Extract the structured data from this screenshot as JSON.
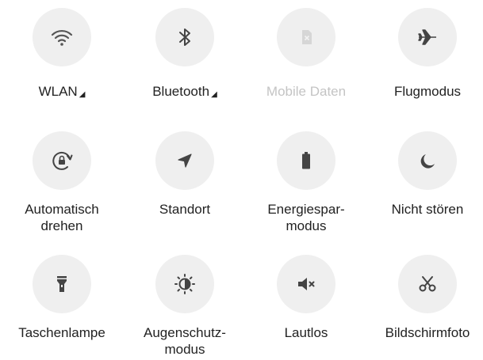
{
  "quick_settings": {
    "tiles": [
      {
        "label": "WLAN",
        "icon": "wifi-icon",
        "has_arrow": true,
        "enabled": true
      },
      {
        "label": "Bluetooth",
        "icon": "bluetooth-icon",
        "has_arrow": true,
        "enabled": true
      },
      {
        "label": "Mobile Daten",
        "icon": "sim-card-icon",
        "has_arrow": false,
        "enabled": false
      },
      {
        "label": "Flugmodus",
        "icon": "airplane-icon",
        "has_arrow": false,
        "enabled": true
      },
      {
        "label": "Automatisch\ndrehen",
        "icon": "auto-rotate-icon",
        "has_arrow": false,
        "enabled": true
      },
      {
        "label": "Standort",
        "icon": "location-icon",
        "has_arrow": false,
        "enabled": true
      },
      {
        "label": "Energiespar-\nmodus",
        "icon": "battery-icon",
        "has_arrow": false,
        "enabled": true
      },
      {
        "label": "Nicht stören",
        "icon": "moon-icon",
        "has_arrow": false,
        "enabled": true
      },
      {
        "label": "Taschenlampe",
        "icon": "flashlight-icon",
        "has_arrow": false,
        "enabled": true
      },
      {
        "label": "Augenschutz-\nmodus",
        "icon": "eye-comfort-icon",
        "has_arrow": false,
        "enabled": true
      },
      {
        "label": "Lautlos",
        "icon": "mute-icon",
        "has_arrow": false,
        "enabled": true
      },
      {
        "label": "Bildschirmfoto",
        "icon": "scissors-icon",
        "has_arrow": false,
        "enabled": true
      }
    ],
    "colors": {
      "circle_bg": "#efefef",
      "icon": "#444444",
      "text": "#222222",
      "disabled": "#c4c4c4"
    },
    "arrow_glyph": "◢"
  }
}
